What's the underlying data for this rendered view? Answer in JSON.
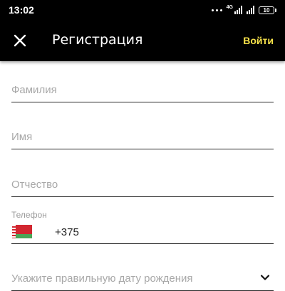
{
  "status_bar": {
    "time": "13:02",
    "network": "4G",
    "battery": "10"
  },
  "app_bar": {
    "title": "Регистрация",
    "login_label": "Войти"
  },
  "form": {
    "last_name": {
      "placeholder": "Фамилия",
      "value": ""
    },
    "first_name": {
      "placeholder": "Имя",
      "value": ""
    },
    "middle_name": {
      "placeholder": "Отчество",
      "value": ""
    },
    "phone": {
      "label": "Телефон",
      "code": "+375",
      "value": ""
    },
    "birth_date": {
      "placeholder": "Укажите правильную дату рождения"
    }
  },
  "icons": {
    "close": "close-icon",
    "flag": "belarus-flag-icon",
    "dropdown": "chevron-down-icon"
  },
  "colors": {
    "accent": "#f7e24a",
    "flag_red": "#d22730",
    "flag_green": "#4aa657"
  }
}
